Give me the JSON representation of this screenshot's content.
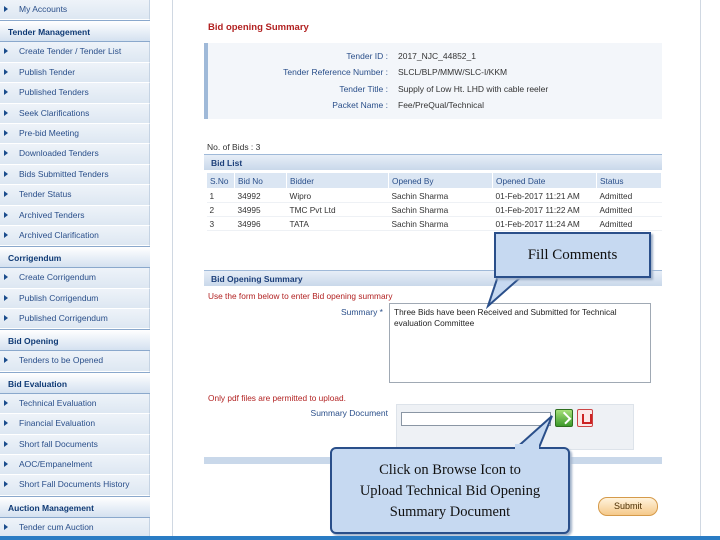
{
  "sidebar": {
    "sections": [
      {
        "heading": "",
        "items": [
          "My Accounts"
        ]
      },
      {
        "heading": "Tender Management",
        "items": [
          "Create Tender / Tender List",
          "Publish Tender",
          "Published Tenders",
          "Seek Clarifications",
          "Pre-bid Meeting",
          "Downloaded Tenders",
          "Bids Submitted Tenders",
          "Tender Status",
          "Archived Tenders",
          "Archived Clarification"
        ]
      },
      {
        "heading": "Corrigendum",
        "items": [
          "Create Corrigendum",
          "Publish Corrigendum",
          "Published Corrigendum"
        ]
      },
      {
        "heading": "Bid Opening",
        "items": [
          "Tenders to be Opened"
        ]
      },
      {
        "heading": "Bid Evaluation",
        "items": [
          "Technical Evaluation",
          "Financial Evaluation",
          "Short fall Documents",
          "AOC/Empanelment",
          "Short Fall Documents History"
        ]
      },
      {
        "heading": "Auction Management",
        "items": [
          "Tender cum Auction"
        ]
      }
    ]
  },
  "page_title": "Bid opening Summary",
  "summary": {
    "tender_id_label": "Tender ID :",
    "tender_id": "2017_NJC_44852_1",
    "ref_label": "Tender Reference Number :",
    "ref": "SLCL/BLP/MMW/SLC-I/KKM",
    "title_label": "Tender Title :",
    "title": "Supply of Low Ht. LHD with cable reeler",
    "packet_label": "Packet Name :",
    "packet": "Fee/PreQual/Technical"
  },
  "no_of_bids": "No. of Bids : 3",
  "bid_list": {
    "heading": "Bid List",
    "columns": [
      "S.No",
      "Bid No",
      "Bidder",
      "Opened By",
      "Opened Date",
      "Status"
    ],
    "rows": [
      [
        "1",
        "34992",
        "Wipro",
        "Sachin Sharma",
        "01-Feb-2017 11:21 AM",
        "Admitted"
      ],
      [
        "2",
        "34995",
        "TMC Pvt Ltd",
        "Sachin Sharma",
        "01-Feb-2017 11:22 AM",
        "Admitted"
      ],
      [
        "3",
        "34996",
        "TATA",
        "Sachin Sharma",
        "01-Feb-2017 11:24 AM",
        "Admitted"
      ]
    ]
  },
  "bid_opening_summary": {
    "heading": "Bid Opening Summary",
    "hint": "Use the form below to enter Bid opening summary",
    "summary_label": "Summary *",
    "summary_value": "Three Bids have been Received and Submitted for Technical evaluation Committee",
    "only_pdf": "Only pdf files are permitted to upload.",
    "document_label": "Summary Document"
  },
  "submit_label": "Submit",
  "callouts": {
    "fill_comments": "Fill Comments",
    "browse_line1": "Click on Browse Icon to",
    "browse_line2": "Upload Technical Bid Opening",
    "browse_line3": "Summary Document"
  },
  "colors": {
    "accent": "#2a4f8a",
    "title_red": "#b22222",
    "callout_fill": "#c6d9f1"
  },
  "icons": {
    "browse": "upload-check-icon",
    "delete": "delete-icon"
  }
}
